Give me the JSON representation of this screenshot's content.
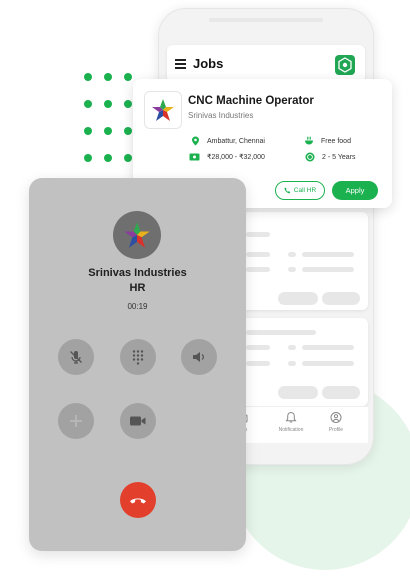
{
  "app": {
    "title": "Jobs"
  },
  "job": {
    "title": "CNC Machine Operator",
    "company": "Srinivas Industries",
    "location": "Ambattur, Chennai",
    "benefit": "Free food",
    "salary": "₹28,000 - ₹32,000",
    "experience": "2 - 5 Years",
    "call_hr_label": "Call HR",
    "apply_label": "Apply"
  },
  "bottom_nav": {
    "items": [
      {
        "label": "Jobs"
      },
      {
        "label": "Notification"
      },
      {
        "label": "Profile"
      }
    ]
  },
  "call": {
    "name": "Srinivas Industries",
    "role": "HR",
    "duration": "00:19"
  },
  "colors": {
    "brand_green": "#1bb14f",
    "end_call_red": "#e23f2c",
    "call_card_gray": "#c1c1c1"
  }
}
